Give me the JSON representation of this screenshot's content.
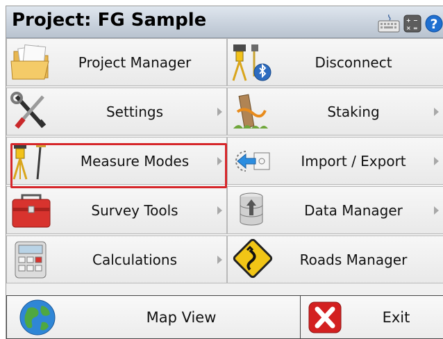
{
  "header": {
    "title": "Project: FG Sample",
    "icons": [
      "keyboard-icon",
      "calculator-icon",
      "help-icon"
    ]
  },
  "menu": {
    "project_manager": "Project Manager",
    "disconnect": "Disconnect",
    "settings": "Settings",
    "staking": "Staking",
    "measure_modes": "Measure Modes",
    "import_export": "Import / Export",
    "survey_tools": "Survey Tools",
    "data_manager": "Data Manager",
    "calculations": "Calculations",
    "roads_manager": "Roads Manager"
  },
  "footer": {
    "map_view": "Map View",
    "exit": "Exit"
  },
  "colors": {
    "highlight": "#d6262a",
    "title_bar": "#c9d2dd",
    "help": "#1f6fd0",
    "exit": "#d32020"
  }
}
